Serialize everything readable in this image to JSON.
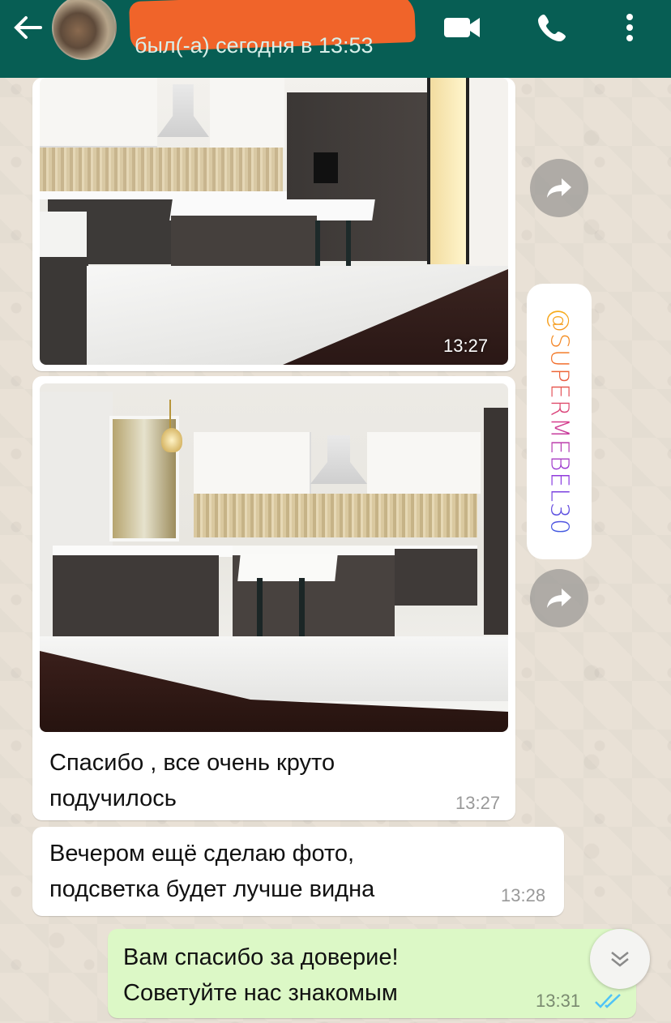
{
  "header": {
    "contact_name": "",
    "last_seen": "был(-а) сегодня в 13:53",
    "back_icon": "arrow-left-icon",
    "video_icon": "video-camera-icon",
    "call_icon": "phone-icon",
    "menu_icon": "more-vertical-icon",
    "bg_color": "#075e54"
  },
  "messages": [
    {
      "type": "image",
      "direction": "incoming",
      "time": "13:27"
    },
    {
      "type": "image",
      "direction": "incoming",
      "caption": "Спасибо , все очень круто подучилось",
      "caption_line1": "Спасибо , все очень круто",
      "caption_line2": "подучилось",
      "time": "13:27"
    },
    {
      "type": "text",
      "direction": "incoming",
      "line1": "Вечером ещё сделаю фото,",
      "line2": "подсветка будет лучше видна",
      "time": "13:28"
    },
    {
      "type": "text",
      "direction": "outgoing",
      "line1": "Вам спасибо за доверие!",
      "line2": "Советуйте нас знакомым",
      "time": "13:31",
      "status": "read"
    }
  ],
  "watermark": {
    "text": "@SUPERMEBEL30"
  },
  "colors": {
    "incoming_bubble": "#ffffff",
    "outgoing_bubble": "#dcf8c6",
    "read_ticks": "#4fc3f7"
  }
}
